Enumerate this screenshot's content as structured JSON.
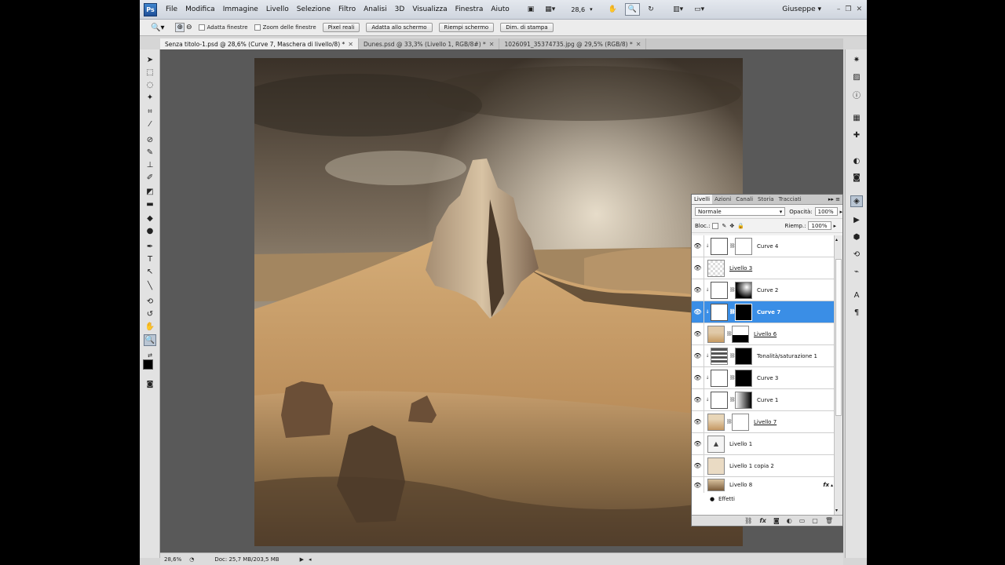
{
  "app": {
    "logo": "Ps",
    "accent": "#3a8ee6"
  },
  "menu": [
    "File",
    "Modifica",
    "Immagine",
    "Livello",
    "Selezione",
    "Filtro",
    "Analisi",
    "3D",
    "Visualizza",
    "Finestra",
    "Aiuto"
  ],
  "menubar": {
    "zoom": "28,6",
    "user": "Giuseppe"
  },
  "options": {
    "check_fit_windows": "Adatta finestre",
    "check_zoom_all": "Zoom delle finestre",
    "btn_actual_pixels": "Pixel reali",
    "btn_fit_screen": "Adatta allo schermo",
    "btn_fill_screen": "Riempi schermo",
    "btn_print_size": "Dim. di stampa"
  },
  "tabs": [
    "Senza titolo-1.psd @ 28,6% (Curve 7, Maschera di livello/8) *",
    "Dunes.psd @ 33,3% (Livello 1, RGB/8#) *",
    "1026091_35374735.jpg @ 29,5% (RGB/8) *"
  ],
  "status": {
    "zoom": "28,6%",
    "doc": "Doc: 25,7 MB/203,5 MB"
  },
  "layers_panel": {
    "tabs": [
      "Livelli",
      "Azioni",
      "Canali",
      "Storia",
      "Tracciati"
    ],
    "blend_mode": "Normale",
    "opacity_label": "Opacità:",
    "opacity_value": "100%",
    "lock_label": "Bloc.:",
    "fill_label": "Riemp.:",
    "fill_value": "100%",
    "effects_label": "Effetti",
    "fx_label": "fx",
    "layers": [
      {
        "name": "Curve 4"
      },
      {
        "name": "Livello 3"
      },
      {
        "name": "Curve 2"
      },
      {
        "name": "Curve 7"
      },
      {
        "name": "Livello 6"
      },
      {
        "name": "Tonalità/saturazione 1"
      },
      {
        "name": "Curve 3"
      },
      {
        "name": "Curve 1"
      },
      {
        "name": "Livello 7"
      },
      {
        "name": "Livello 1"
      },
      {
        "name": "Livello 1 copia 2"
      },
      {
        "name": "Livello 8"
      }
    ]
  }
}
